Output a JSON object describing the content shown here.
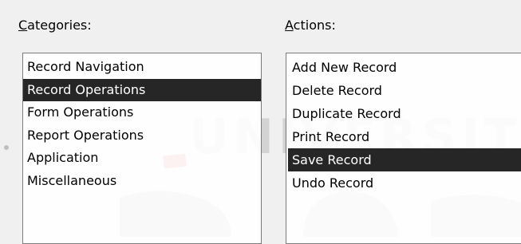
{
  "categories": {
    "label": "Categories:",
    "label_accel": "C",
    "label_rest": "ategories:",
    "items": [
      "Record Navigation",
      "Record Operations",
      "Form Operations",
      "Report Operations",
      "Application",
      "Miscellaneous"
    ],
    "selected_index": 1
  },
  "actions": {
    "label": "Actions:",
    "label_accel": "A",
    "label_rest": "ctions:",
    "items": [
      "Add New Record",
      "Delete Record",
      "Duplicate Record",
      "Print Record",
      "Save Record",
      "Undo Record"
    ],
    "selected_index": 4
  },
  "watermark": {
    "text": "UNIVERSITAS",
    "color": "#bdbdbd",
    "accent_color": "#e36b6b"
  },
  "colors": {
    "background": "#f0f0f0",
    "selection": "#262626",
    "list_border": "#7a7a7a"
  }
}
